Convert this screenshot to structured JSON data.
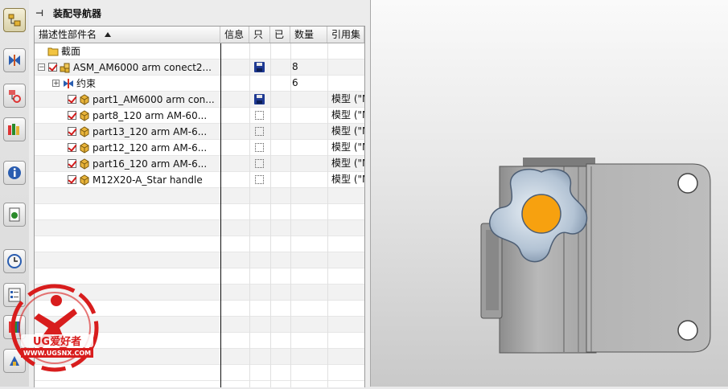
{
  "navigator": {
    "title": "装配导航器",
    "columns": [
      "描述性部件名",
      "信息",
      "只",
      "已",
      "数量",
      "引用集"
    ],
    "rows": [
      {
        "level": 0,
        "name": "截面",
        "type": "folder",
        "info": "",
        "readonly": "",
        "loaded": "",
        "qty": "",
        "refset": ""
      },
      {
        "level": 0,
        "name": "ASM_AM6000 arm conect2...",
        "type": "assembly",
        "expander": "−",
        "checked": true,
        "readonly": "disk",
        "qty": "8",
        "refset": ""
      },
      {
        "level": 1,
        "name": "约束",
        "type": "constraint",
        "expander": "+",
        "qty": "6",
        "refset": ""
      },
      {
        "level": 2,
        "name": "part1_AM6000 arm con...",
        "type": "part",
        "checked": true,
        "readonly": "disk",
        "qty": "",
        "refset": "模型 (\"M"
      },
      {
        "level": 2,
        "name": "part8_120 arm AM-60...",
        "type": "part",
        "checked": true,
        "readonly": "box",
        "qty": "",
        "refset": "模型 (\"M"
      },
      {
        "level": 2,
        "name": "part13_120 arm AM-6...",
        "type": "part",
        "checked": true,
        "readonly": "box",
        "qty": "",
        "refset": "模型 (\"M"
      },
      {
        "level": 2,
        "name": "part12_120 arm AM-6...",
        "type": "part",
        "checked": true,
        "readonly": "box",
        "qty": "",
        "refset": "模型 (\"M"
      },
      {
        "level": 2,
        "name": "part16_120 arm AM-6...",
        "type": "part",
        "checked": true,
        "readonly": "box",
        "qty": "",
        "refset": "模型 (\"M"
      },
      {
        "level": 2,
        "name": "M12X20-A_Star handle",
        "type": "part",
        "checked": true,
        "readonly": "box",
        "qty": "",
        "refset": "模型 (\"M"
      }
    ],
    "empty_rows": 12
  },
  "sidebar": {
    "items": [
      {
        "name": "assembly-navigator-icon",
        "active": true
      },
      {
        "name": "constraint-navigator-icon"
      },
      {
        "name": "part-navigator-icon"
      },
      {
        "name": "reuse-library-icon"
      },
      {
        "name": "info-icon"
      },
      {
        "name": "web-browser-icon"
      },
      {
        "name": "history-icon"
      },
      {
        "name": "system-materials-icon"
      },
      {
        "name": "roles-icon"
      },
      {
        "name": "palette-icon"
      }
    ]
  },
  "watermark": {
    "brand": "UG爱好者",
    "url": "WWW.UGSNX.COM"
  },
  "colors": {
    "knob_center": "#f7a10f",
    "watermark_red": "#d81d1d",
    "part_body": "#a9a9a9"
  }
}
